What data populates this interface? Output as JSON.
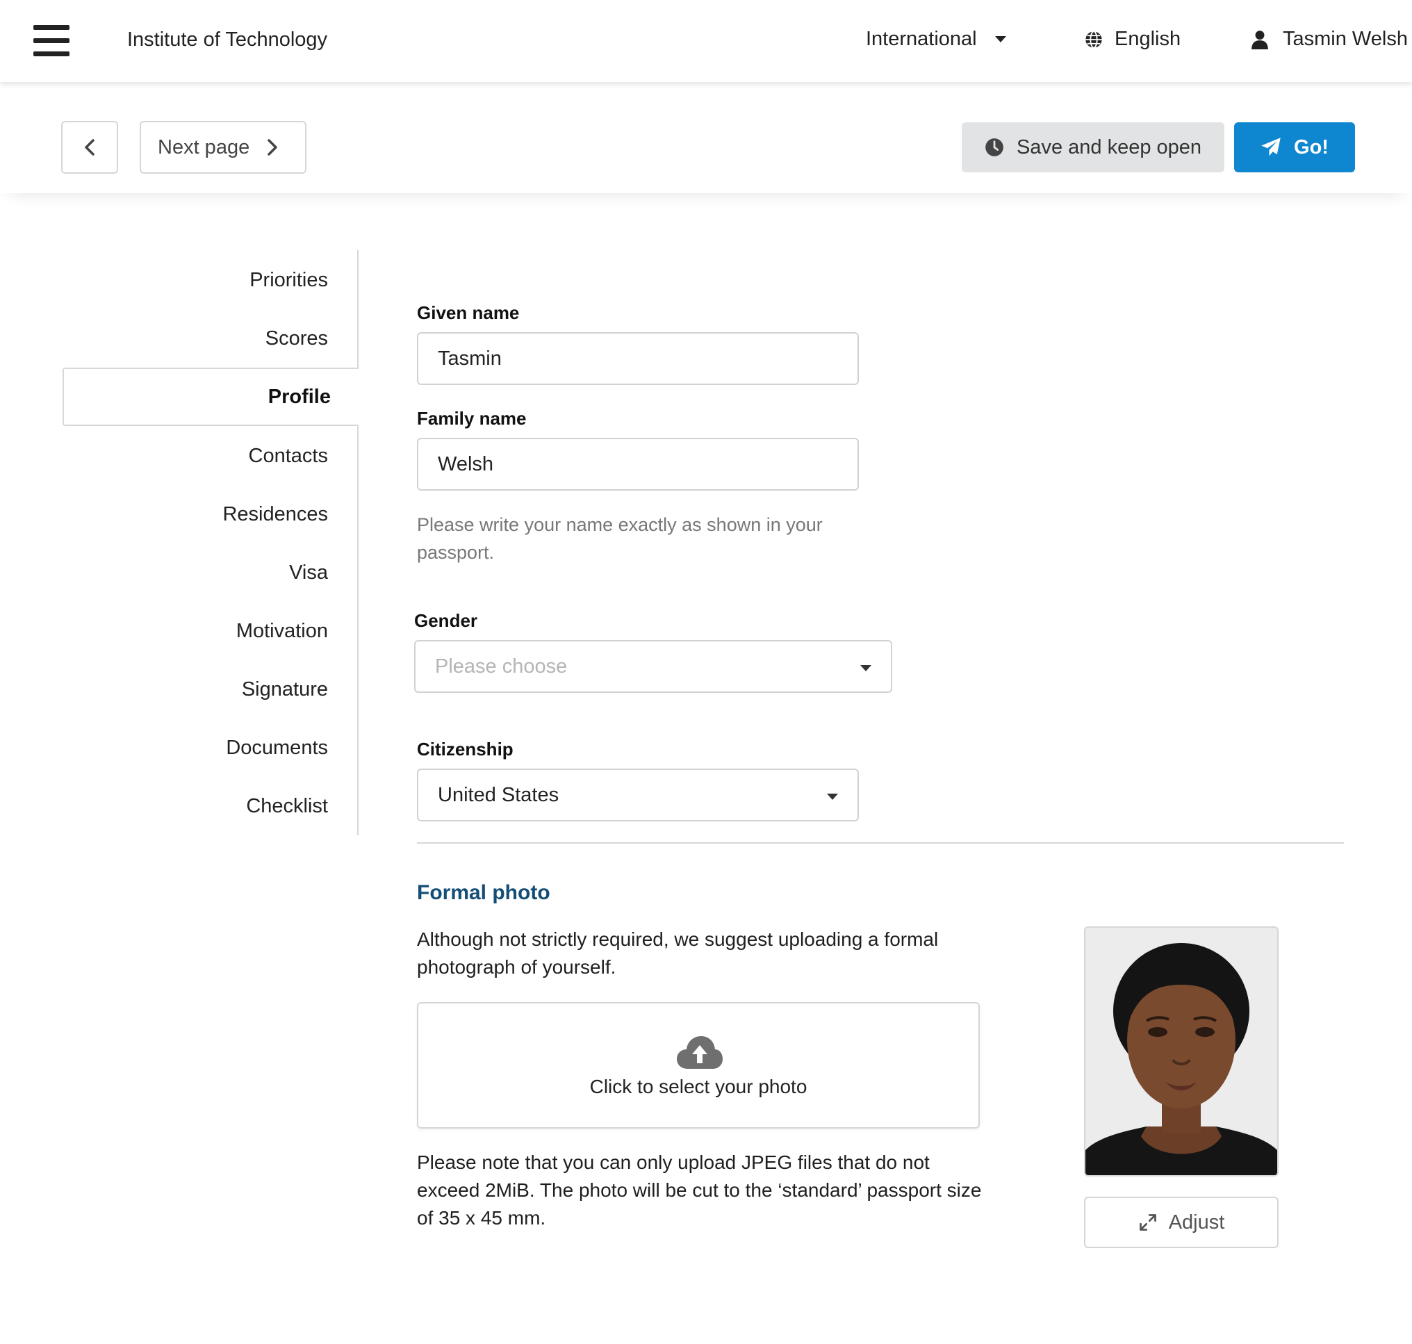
{
  "topbar": {
    "menu_icon": "hamburger-menu-icon",
    "brand": "Institute of Technology",
    "scope": "International",
    "language": "English",
    "user": "Tasmin Welsh"
  },
  "actions": {
    "prev_icon": "chevron-left-icon",
    "next_label": "Next page",
    "save_label": "Save and keep open",
    "go_label": "Go!"
  },
  "sidenav": {
    "items": [
      "Priorities",
      "Scores",
      "Profile",
      "Contacts",
      "Residences",
      "Visa",
      "Motivation",
      "Signature",
      "Documents",
      "Checklist"
    ],
    "active": "Profile"
  },
  "form": {
    "given_name_label": "Given name",
    "given_name_value": "Tasmin",
    "family_name_label": "Family name",
    "family_name_value": "Welsh",
    "name_help": "Please write your name exactly as shown in your passport.",
    "gender_label": "Gender",
    "gender_placeholder": "Please choose",
    "citizenship_label": "Citizenship",
    "citizenship_value": "United States"
  },
  "photo_section": {
    "title": "Formal photo",
    "intro": "Although not strictly required, we suggest uploading a formal photograph of yourself.",
    "upload_label": "Click to select your photo",
    "note": "Please note that you can only upload JPEG files that do not exceed 2MiB. The photo will be cut to the ‘standard’ passport size of 35 x 45 mm.",
    "adjust_label": "Adjust"
  },
  "colors": {
    "primary": "#0e86d0",
    "section_title": "#144e76",
    "save_bg": "#e2e3e4"
  }
}
